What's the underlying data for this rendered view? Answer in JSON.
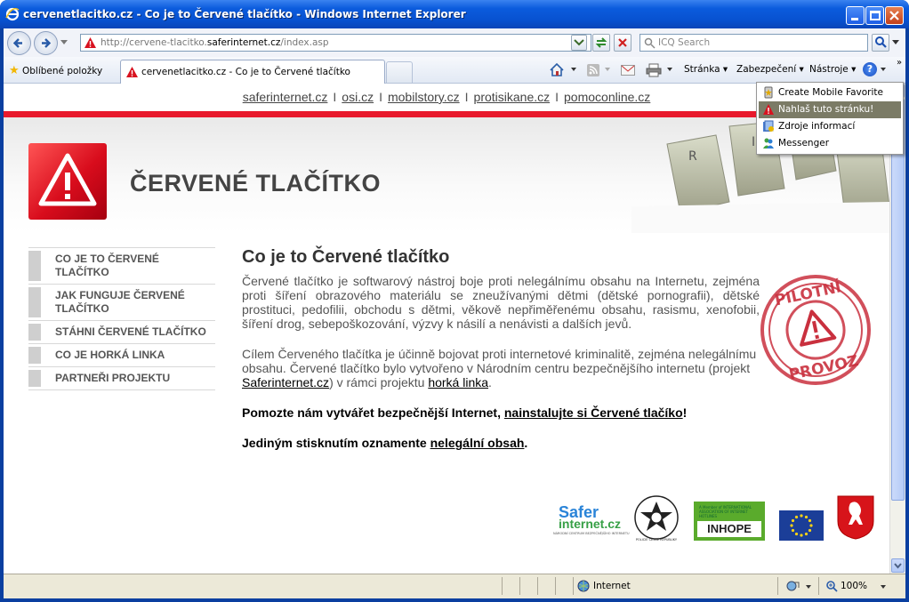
{
  "window": {
    "title": "cervenetlacitko.cz - Co je to Červené tlačítko - Windows Internet Explorer"
  },
  "navbar": {
    "url_prefix": "http://cervene-tlacitko.",
    "url_domain": "saferinternet.cz",
    "url_suffix": "/index.asp",
    "search_placeholder": "ICQ Search"
  },
  "commandbar": {
    "favorites_label": "Oblíbené položky",
    "tab_title": "cervenetlacitko.cz - Co je to Červené tlačítko",
    "page_menu": "Stránka",
    "security_menu": "Zabezpečení",
    "tools_menu": "Nástroje"
  },
  "dropdown": {
    "items": [
      "Create Mobile Favorite",
      "Nahlaš tuto stránku!",
      "Zdroje informací",
      "Messenger"
    ],
    "selected_index": 1
  },
  "page": {
    "top_links": [
      "saferinternet.cz",
      "osi.cz",
      "mobilstory.cz",
      "protisikane.cz",
      "pomoconline.cz"
    ],
    "site_title": "ČERVENÉ TLAČÍTKO",
    "sidebar": [
      "CO JE TO ČERVENÉ TLAČÍTKO",
      "JAK FUNGUJE ČERVENÉ TLAČÍTKO",
      "STÁHNI ČERVENÉ TLAČÍTKO",
      "CO JE HORKÁ LINKA",
      "PARTNEŘI PROJEKTU"
    ],
    "heading": "Co je to Červené tlačítko",
    "para1": "Červené tlačítko je softwarový nástroj boje proti nelegálnímu obsahu na Internetu, zejména proti šíření obrazového materiálu se zneužívanými dětmi (dětské pornografii), dětské prostituci, pedofilii, obchodu s dětmi, věkově nepřiměřenému obsahu, rasismu, xenofobii, šíření drog, sebepoškozování, výzvy k násilí a nenávisti a dalších jevů.",
    "para2_text": "Cílem Červeného tlačítka je účinně bojovat proti internetové kriminalitě, zejména nelegálnímu obsahu. Červené tlačítko bylo vytvořeno v Národním centru bezpečnějšího internetu (projekt",
    "para2_link1": "Saferinternet.cz",
    "para2_mid": ") v rámci projektu",
    "para2_link2": "horká linka",
    "para2_end": ".",
    "help_text": "Pomozte nám vytvářet bezpečnější Internet,",
    "help_link": "nainstalujte si Červené tlačíko",
    "help_end": "!",
    "report_text": "Jediným stisknutím oznamente",
    "report_link": "nelegální obsah",
    "report_end": ".",
    "stamp_top": "PILOTNÍ",
    "stamp_bottom": "PROVOZ",
    "keys_letters": [
      "R",
      "I"
    ],
    "partners": {
      "safer_line1": "Safer",
      "safer_line2": "internet.cz",
      "safer_small": "NÁRODNÍ CENTRUM BEZPEČNĚJŠÍHO INTERNETU",
      "police_text": "POLICIE ČESKÉ REPUBLIKY",
      "inhope_small": "A Member of INTERNATIONAL ASSOCIATION OF INTERNET HOTLINES",
      "inhope": "INHOPE"
    }
  },
  "statusbar": {
    "zone": "Internet",
    "zoom": "100%"
  },
  "colors": {
    "accent_red": "#e8192c",
    "xp_blue": "#0b5bdd"
  }
}
